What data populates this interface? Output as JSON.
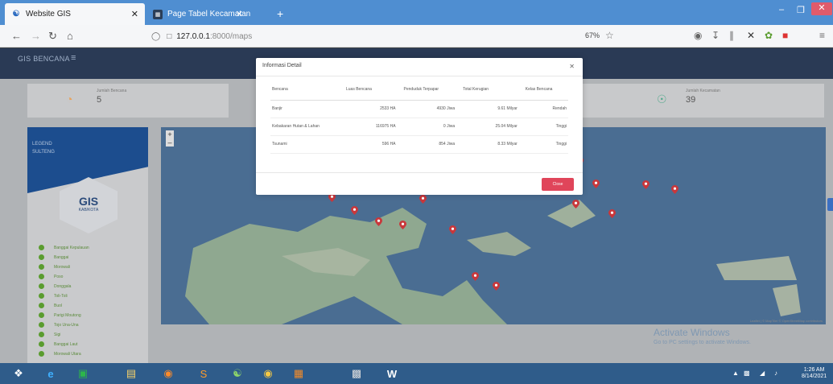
{
  "browser": {
    "tabs": [
      {
        "label": "Website GIS",
        "active": true
      },
      {
        "label": "Page Tabel Kecamatan",
        "active": false
      }
    ],
    "url_host": "127.0.0.1",
    "url_path": ":8000/maps",
    "zoom": "67%"
  },
  "app": {
    "brand": "GIS BENCANA",
    "stats": [
      {
        "label": "Jumlah Bencana",
        "value": "5"
      },
      {
        "label": "Jumlah Kecamatan",
        "value": "39"
      }
    ],
    "legend": {
      "title_line1": "LEGEND",
      "title_line2": "SULTENG",
      "badge_title": "GIS",
      "badge_sub": "KAB/KOTA",
      "items": [
        "Banggai Kepulauan",
        "Banggai",
        "Morowali",
        "Poso",
        "Donggala",
        "Toli-Toli",
        "Buol",
        "Parigi Moutong",
        "Tojo Una-Una",
        "Sigi",
        "Banggai Laut",
        "Morowali Utara"
      ]
    }
  },
  "modal": {
    "title": "Informasi Detail",
    "close_label": "Close",
    "headers": [
      "Bencana",
      "Luas Bencana",
      "Penduduk Terpapar",
      "Total Kerugian",
      "Kelas Bencana"
    ],
    "rows": [
      [
        "Banjir",
        "2533 HA",
        "4930 Jiwa",
        "9.61 Milyar",
        "Rendah"
      ],
      [
        "Kebakaran Hutan & Lahan",
        "116975 HA",
        "0 Jiwa",
        "25.04 Milyar",
        "Tinggi"
      ],
      [
        "Tsunami",
        "596 HA",
        "854 Jiwa",
        "8.33 Milyar",
        "Tinggi"
      ]
    ]
  },
  "map": {
    "attribution": "Leaflet | © MapTiler © OpenStreetMap contributors",
    "watermark_title": "Activate Windows",
    "watermark_sub": "Go to PC settings to activate Windows."
  },
  "taskbar": {
    "time": "1:26 AM",
    "date": "8/14/2021"
  },
  "colors": {
    "accent": "#2a3a55",
    "close_button": "#e0455a",
    "map_water": "#4a6d92",
    "marker": "#c9373b"
  }
}
